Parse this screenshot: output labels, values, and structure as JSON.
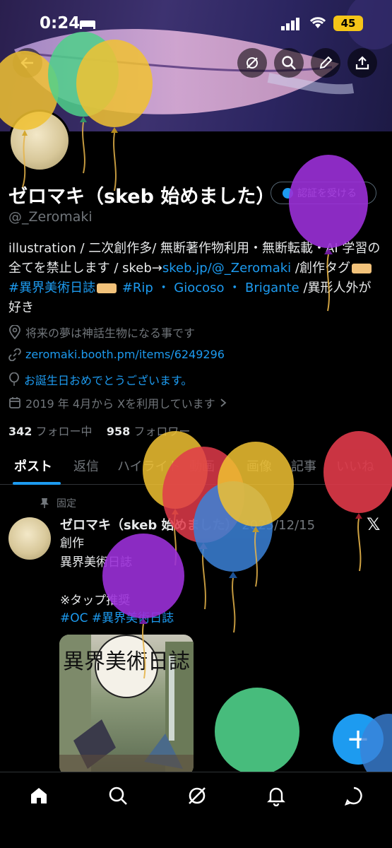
{
  "status_bar": {
    "time": "0:24",
    "battery": "45"
  },
  "profile": {
    "name": "ゼロマキ（skeb 始めました）",
    "handle": "@_Zeromaki",
    "verify_button": "認証を受ける",
    "bio_segments": [
      {
        "text": "illustration / 二次創作多/ 無断著作物利用・無断転載・AI 学習の全てを禁止します / skeb→",
        "link": false
      },
      {
        "text": "skeb.jp/@_Zeromaki",
        "link": true
      },
      {
        "text": " /創作タグ",
        "link": false
      },
      {
        "text": "#異界美術日誌",
        "link": true
      },
      {
        "text": " ",
        "link": false
      },
      {
        "text": "#Rip ・ Giocoso ・ Brigante",
        "link": true
      },
      {
        "text": " /異形人外が好き",
        "link": false
      }
    ],
    "location": "将来の夢は神話生物になる事です",
    "website": "zeromaki.booth.pm/items/6249296",
    "birthday": "お誕生日おめでとうございます。",
    "joined": "2019 年 4月から Xを利用しています",
    "following_count": "342",
    "following_label": "フォロー中",
    "followers_count": "958",
    "followers_label": "フォロワー"
  },
  "tabs": [
    "ポスト",
    "返信",
    "ハイライト",
    "動画",
    "画像",
    "記事",
    "いいね"
  ],
  "post": {
    "pinned_label": "固定",
    "author": "ゼロマキ（skeb 始めました）",
    "date": "2025/12/15",
    "lines": [
      "創作",
      "異界美術日誌",
      "",
      "※タップ推奨"
    ],
    "hashtags": "#OC #異界美術日誌",
    "image_text": "異界美術日誌"
  },
  "fab_label": "+",
  "colors": {
    "accent": "#1d9bf0",
    "background": "#000000",
    "muted": "#71767b"
  }
}
